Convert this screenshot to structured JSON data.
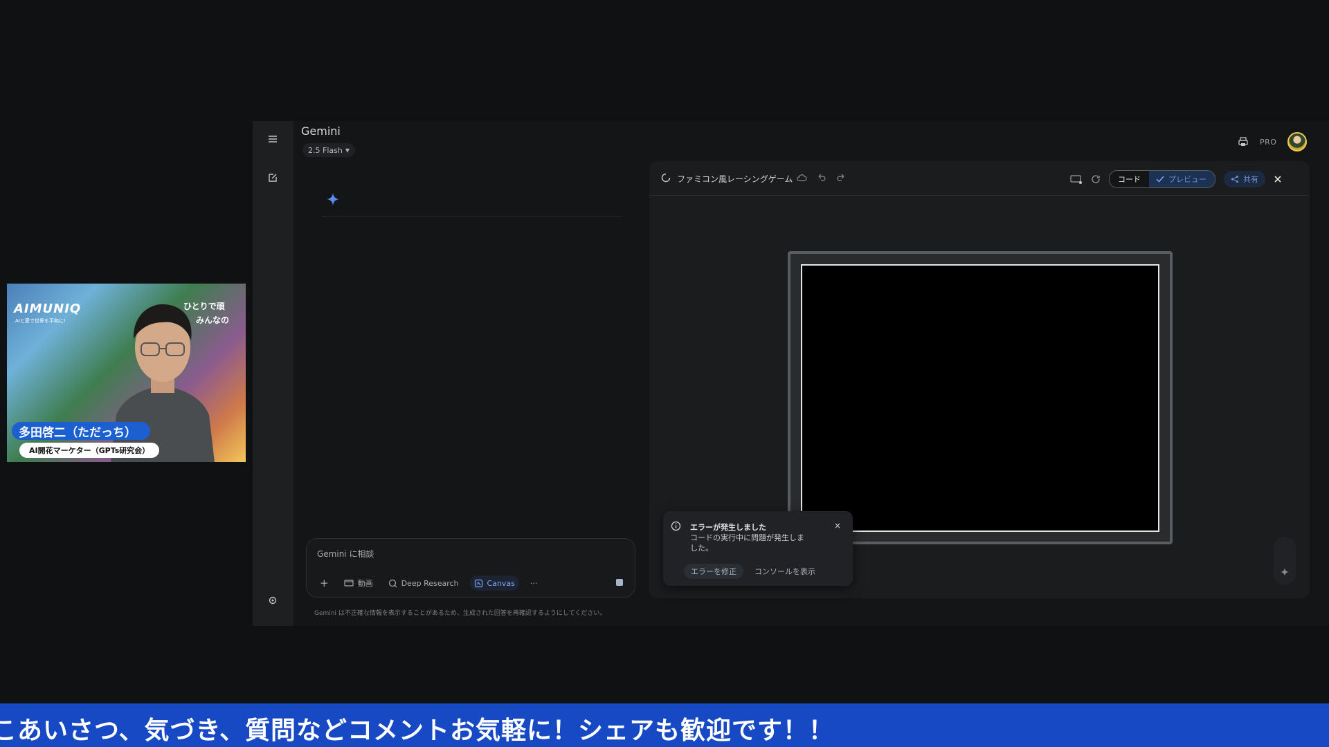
{
  "app": {
    "title": "Gemini",
    "model": "2.5 Flash",
    "pro_label": "PRO"
  },
  "composer": {
    "placeholder": "Gemini に相談",
    "tools": {
      "add": "+",
      "video": "動画",
      "deep_research": "Deep Research",
      "canvas": "Canvas",
      "more": "···"
    },
    "disclaimer": "Gemini は不正確な情報を表示することがあるため、生成された回答を再確認するようにしてください。"
  },
  "canvas": {
    "title": "ファミコン風レーシングゲーム",
    "code_label": "コード",
    "preview_label": "プレビュー",
    "share_label": "共有"
  },
  "error_toast": {
    "title": "エラーが発生しました",
    "body": "コードの実行中に問題が発生しました。",
    "fix_label": "エラーを修正",
    "console_label": "コンソールを表示",
    "close": "×"
  },
  "webcam": {
    "brand": "AIMUNIQ",
    "brand_sub": "AIと愛で世界を平和に!",
    "tagline_1": "ひとりで頑",
    "tagline_2": "みんなの",
    "name": "多田啓二（ただっち）",
    "role": "AI開花マーケター（GPTs研究会）"
  },
  "ticker": {
    "text": "こあいさつ、気づき、質問などコメントお気軽に！シェアも歓迎です！！"
  },
  "colors": {
    "ticker_bg": "#1749c4",
    "accent": "#7da8f5",
    "name_badge": "#1b5fd1"
  }
}
